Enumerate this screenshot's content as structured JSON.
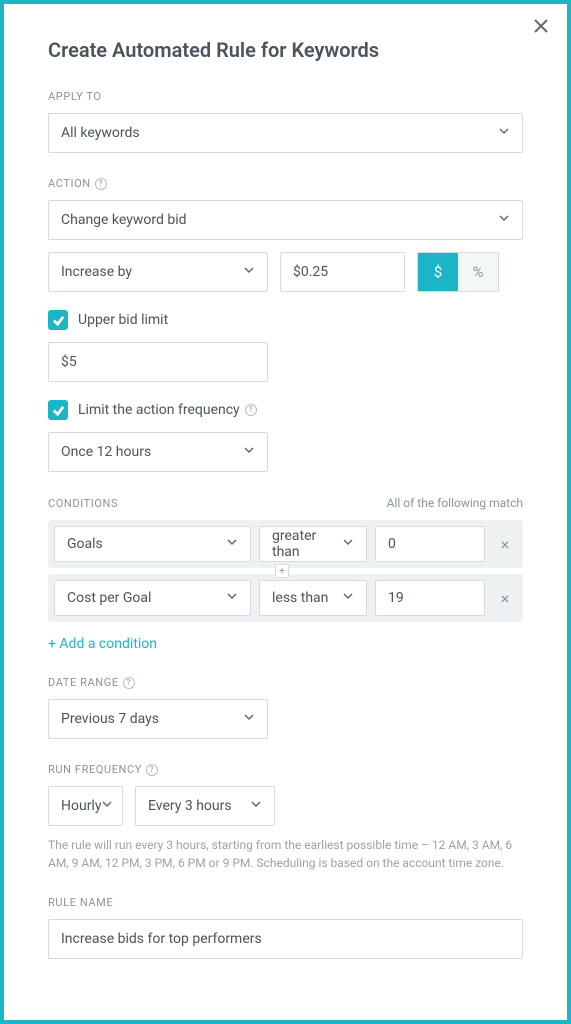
{
  "title": "Create Automated Rule for Keywords",
  "applyTo": {
    "label": "APPLY TO",
    "value": "All keywords"
  },
  "action": {
    "label": "ACTION",
    "value": "Change keyword bid",
    "direction": "Increase by",
    "amount": "$0.25",
    "unit_dollar": "$",
    "unit_percent": "%"
  },
  "upperLimit": {
    "label": "Upper bid limit",
    "value": "$5"
  },
  "limitFreq": {
    "label": "Limit the action frequency",
    "value": "Once 12 hours"
  },
  "conditions": {
    "label": "CONDITIONS",
    "match_note": "All of the following match",
    "rows": [
      {
        "metric": "Goals",
        "op": "greater than",
        "value": "0"
      },
      {
        "metric": "Cost per Goal",
        "op": "less than",
        "value": "19"
      }
    ],
    "add_label": "+ Add a condition"
  },
  "dateRange": {
    "label": "DATE RANGE",
    "value": "Previous 7 days"
  },
  "runFreq": {
    "label": "RUN FREQUENCY",
    "unit": "Hourly",
    "interval": "Every 3 hours",
    "note": "The rule will run every 3 hours, starting from the earliest possible time – 12 AM, 3 AM, 6 AM, 9 AM, 12 PM, 3 PM, 6 PM or 9 PM. Scheduling is based on the account time zone."
  },
  "ruleName": {
    "label": "RULE NAME",
    "value": "Increase bids for top performers"
  }
}
